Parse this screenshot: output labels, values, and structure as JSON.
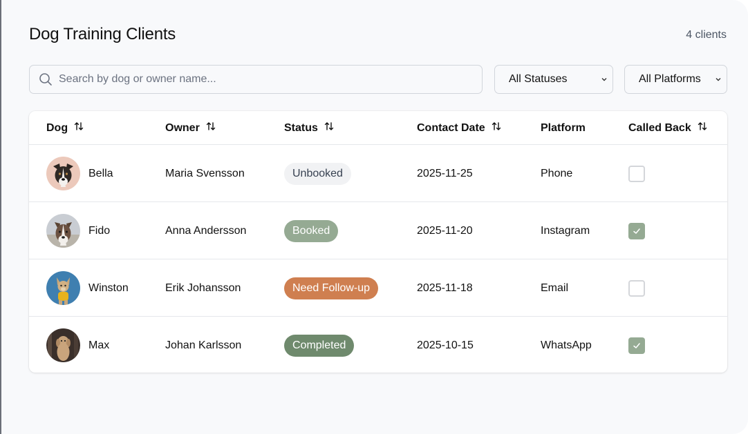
{
  "header": {
    "title": "Dog Training Clients",
    "count": "4 clients"
  },
  "search": {
    "placeholder": "Search by dog or owner name...",
    "value": ""
  },
  "filters": {
    "status": "All Statuses",
    "platform": "All Platforms"
  },
  "columns": [
    "Dog",
    "Owner",
    "Status",
    "Contact Date",
    "Platform",
    "Called Back"
  ],
  "rows": [
    {
      "dog": "Bella",
      "owner": "Maria Svensson",
      "status": "Unbooked",
      "date": "2025-11-25",
      "platform": "Phone",
      "called_back": false
    },
    {
      "dog": "Fido",
      "owner": "Anna Andersson",
      "status": "Booked",
      "date": "2025-11-20",
      "platform": "Instagram",
      "called_back": true
    },
    {
      "dog": "Winston",
      "owner": "Erik Johansson",
      "status": "Need Follow-up",
      "date": "2025-11-18",
      "platform": "Email",
      "called_back": false
    },
    {
      "dog": "Max",
      "owner": "Johan Karlsson",
      "status": "Completed",
      "date": "2025-10-15",
      "platform": "WhatsApp",
      "called_back": true
    }
  ],
  "status_colors": {
    "Unbooked": {
      "bg": "#f1f2f4",
      "fg": "#374151"
    },
    "Booked": {
      "bg": "#95aa93",
      "fg": "#ffffff"
    },
    "Need Follow-up": {
      "bg": "#cf7f50",
      "fg": "#ffffff"
    },
    "Completed": {
      "bg": "#6f8a6d",
      "fg": "#ffffff"
    }
  },
  "icons": {
    "search": "search-icon",
    "sort": "sort-arrows-icon",
    "select": "chevron-down-icon",
    "check": "check-icon"
  }
}
